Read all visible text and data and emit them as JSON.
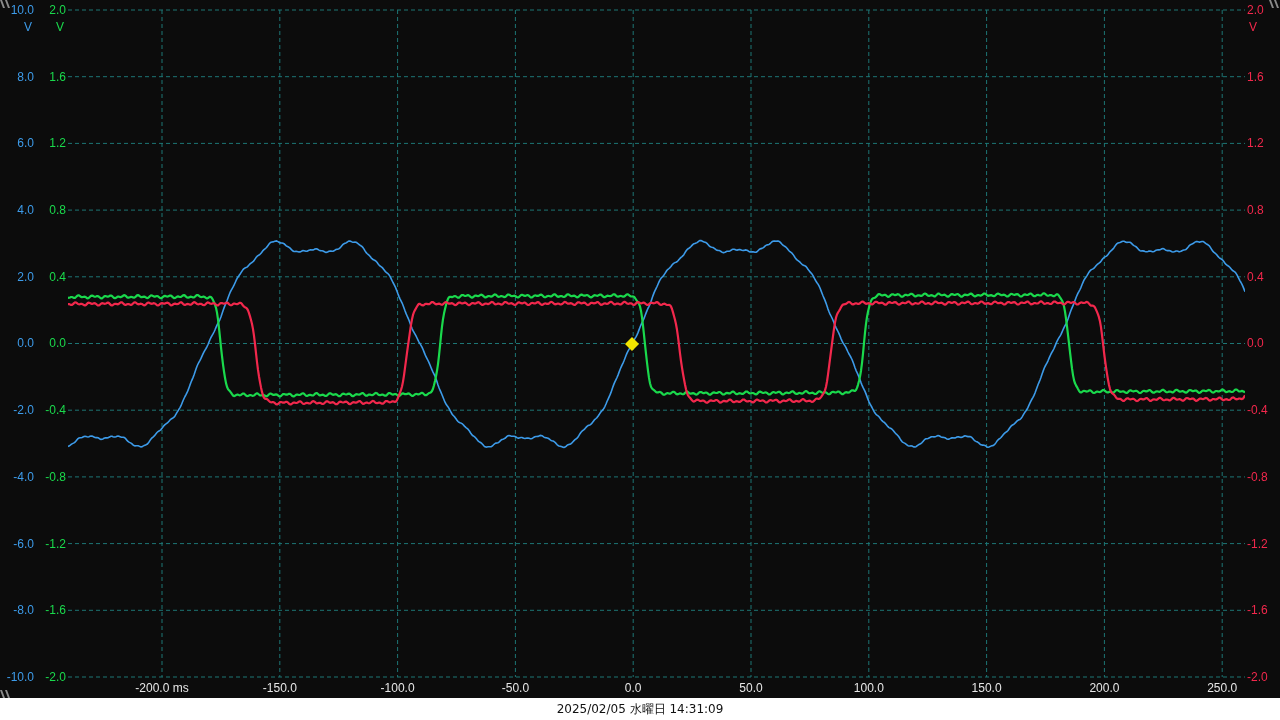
{
  "scope": {
    "left_axes": [
      {
        "unit": "V",
        "color": "#3d9be9",
        "ticks": [
          "10.0",
          "8.0",
          "6.0",
          "4.0",
          "2.0",
          "0.0",
          "-2.0",
          "-4.0",
          "-6.0",
          "-8.0",
          "-10.0"
        ]
      },
      {
        "unit": "V",
        "color": "#1ad94c",
        "ticks": [
          "2.0",
          "1.6",
          "1.2",
          "0.8",
          "0.4",
          "0.0",
          "-0.4",
          "-0.8",
          "-1.2",
          "-1.6",
          "-2.0"
        ]
      }
    ],
    "right_axis": {
      "unit": "V",
      "color": "#f2284c",
      "ticks": [
        "2.0",
        "1.6",
        "1.2",
        "0.8",
        "0.4",
        "0.0",
        "-0.4",
        "-0.8",
        "-1.2",
        "-1.6",
        "-2.0"
      ]
    },
    "x_ticks": [
      "-200.0 ms",
      "-150.0",
      "-100.0",
      "-50.0",
      "0.0",
      "50.0",
      "100.0",
      "150.0",
      "200.0",
      "250.0"
    ]
  },
  "status_bar": {
    "timestamp": "2025/02/05 水曜日 14:31:09"
  }
}
